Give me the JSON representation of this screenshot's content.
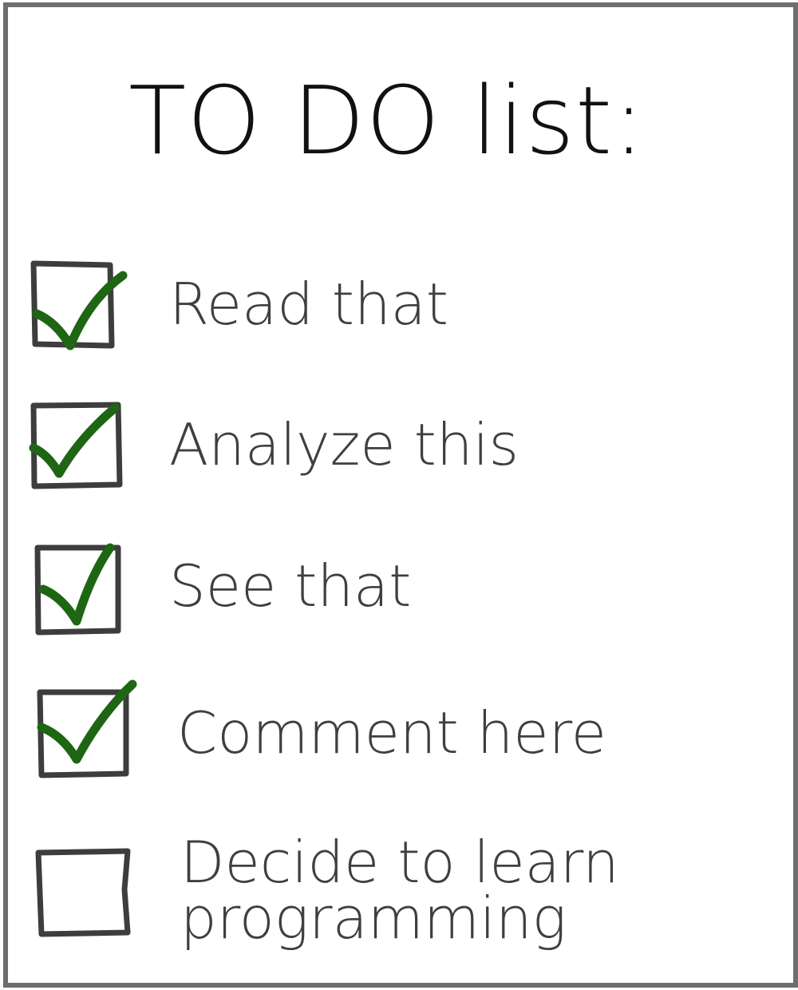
{
  "title": "TO DO list:",
  "colors": {
    "border": "#6e6e6e",
    "checkbox": "#3d3d3d",
    "check": "#1e6614",
    "text": "#3f3f3f",
    "title": "#111111"
  },
  "items": [
    {
      "label": "Read that",
      "checked": true,
      "icon": "checkmark-icon"
    },
    {
      "label": "Analyze this",
      "checked": true,
      "icon": "checkmark-icon"
    },
    {
      "label": "See that",
      "checked": true,
      "icon": "checkmark-icon"
    },
    {
      "label": "Comment here",
      "checked": true,
      "icon": "checkmark-icon"
    },
    {
      "label": "Decide to learn programming",
      "checked": false,
      "icon": "empty-checkbox-icon"
    }
  ]
}
